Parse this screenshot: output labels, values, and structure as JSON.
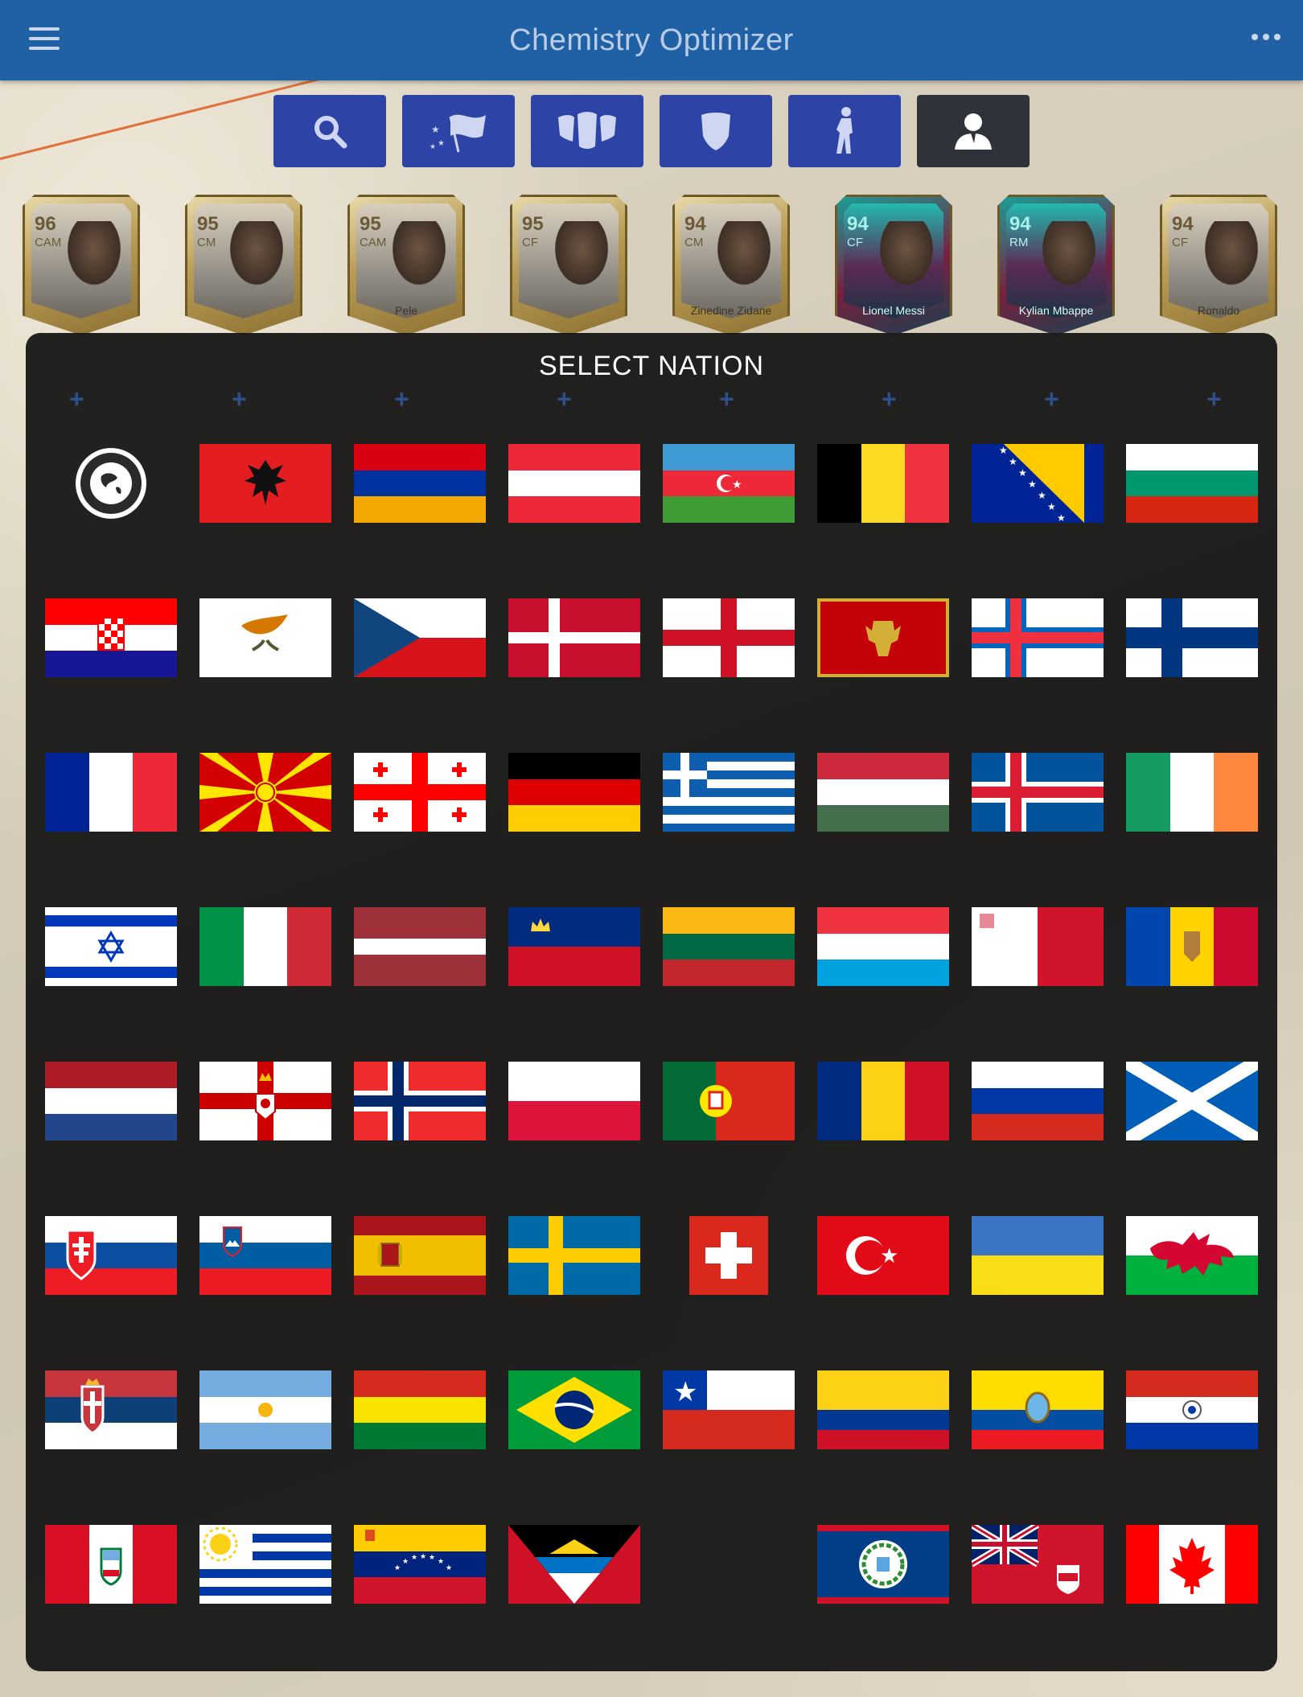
{
  "appbar": {
    "title": "Chemistry Optimizer"
  },
  "filters": [
    {
      "name": "search-icon",
      "label": "Search"
    },
    {
      "name": "nation-flag-icon",
      "label": "Nation"
    },
    {
      "name": "league-icon",
      "label": "League"
    },
    {
      "name": "club-shield-icon",
      "label": "Club"
    },
    {
      "name": "position-player-icon",
      "label": "Position"
    },
    {
      "name": "manager-icon",
      "label": "Manager"
    }
  ],
  "player_cards": [
    {
      "rating": "96",
      "position": "CAM",
      "name": ""
    },
    {
      "rating": "95",
      "position": "CM",
      "name": ""
    },
    {
      "rating": "95",
      "position": "CAM",
      "name": "Pele"
    },
    {
      "rating": "95",
      "position": "CF",
      "name": ""
    },
    {
      "rating": "94",
      "position": "CM",
      "name": "Zinedine Zidane"
    },
    {
      "rating": "94",
      "position": "CF",
      "name": "Lionel Messi"
    },
    {
      "rating": "94",
      "position": "RM",
      "name": "Kylian Mbappe"
    },
    {
      "rating": "94",
      "position": "CF",
      "name": "Ronaldo"
    }
  ],
  "modal": {
    "title": "SELECT NATION",
    "nations": [
      "Rest of World",
      "Albania",
      "Armenia",
      "Austria",
      "Azerbaijan",
      "Belgium",
      "Bosnia and Herzegovina",
      "Bulgaria",
      "Croatia",
      "Cyprus",
      "Czech Republic",
      "Denmark",
      "England",
      "Montenegro",
      "Faroe Islands",
      "Finland",
      "France",
      "North Macedonia",
      "Georgia",
      "Germany",
      "Greece",
      "Hungary",
      "Iceland",
      "Republic of Ireland",
      "Israel",
      "Italy",
      "Latvia",
      "Liechtenstein",
      "Lithuania",
      "Luxembourg",
      "Malta",
      "Moldova",
      "Netherlands",
      "Northern Ireland",
      "Norway",
      "Poland",
      "Portugal",
      "Romania",
      "Russia",
      "Scotland",
      "Slovakia",
      "Slovenia",
      "Spain",
      "Sweden",
      "Switzerland",
      "Turkey",
      "Ukraine",
      "Wales",
      "Serbia",
      "Argentina",
      "Bolivia",
      "Brazil",
      "Chile",
      "Colombia",
      "Ecuador",
      "Paraguay",
      "Peru",
      "Uruguay",
      "Venezuela",
      "Antigua and Barbuda",
      "",
      "Belize",
      "Bermuda",
      "Canada"
    ]
  }
}
